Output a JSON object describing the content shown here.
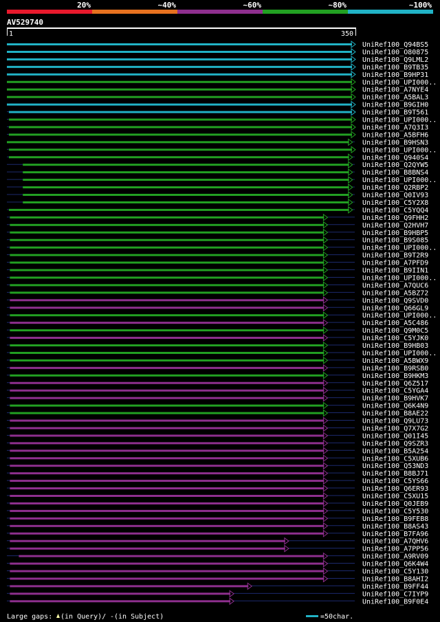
{
  "query_name": "AV529740",
  "colors": {
    "c20": "#e8192c",
    "c40": "#e6711f",
    "c60": "#8e2f8e",
    "c80": "#22a022",
    "c100": "#21b3c6"
  },
  "chart_data": {
    "type": "alignment-overview",
    "query_length": 350,
    "ruler_start": "1",
    "ruler_end": "350",
    "identity_scale": [
      {
        "label": "20%",
        "color": "#e8192c"
      },
      {
        "label": "~40%",
        "color": "#e6711f"
      },
      {
        "label": "~60%",
        "color": "#8e2f8e"
      },
      {
        "label": "~80%",
        "color": "#22a022"
      },
      {
        "label": "~100%",
        "color": "#21b3c6"
      }
    ],
    "hits": [
      {
        "name": "UniRef100_Q94BS5",
        "start": 1,
        "end": 350,
        "color": "#21b3c6"
      },
      {
        "name": "UniRef100_O80875",
        "start": 1,
        "end": 350,
        "color": "#21b3c6"
      },
      {
        "name": "UniRef100_Q9LML2",
        "start": 1,
        "end": 350,
        "color": "#21b3c6"
      },
      {
        "name": "UniRef100_B9TB35",
        "start": 1,
        "end": 350,
        "color": "#21b3c6"
      },
      {
        "name": "UniRef100_B9HP31",
        "start": 1,
        "end": 350,
        "color": "#21b3c6"
      },
      {
        "name": "UniRef100_UPI000..",
        "start": 1,
        "end": 350,
        "color": "#22a022"
      },
      {
        "name": "UniRef100_A7NYE4",
        "start": 1,
        "end": 350,
        "color": "#22a022"
      },
      {
        "name": "UniRef100_A5BAL3",
        "start": 1,
        "end": 350,
        "color": "#22a022"
      },
      {
        "name": "UniRef100_B9GIH0",
        "start": 1,
        "end": 350,
        "color": "#21b3c6"
      },
      {
        "name": "UniRef100_B9T561",
        "start": 3,
        "end": 350,
        "color": "#21b3c6"
      },
      {
        "name": "UniRef100_UPI000..",
        "start": 3,
        "end": 350,
        "color": "#22a022"
      },
      {
        "name": "UniRef100_A7Q3I3",
        "start": 3,
        "end": 350,
        "color": "#22a022"
      },
      {
        "name": "UniRef100_A5BFH6",
        "start": 3,
        "end": 350,
        "color": "#22a022"
      },
      {
        "name": "UniRef100_B9HSN3",
        "start": 1,
        "end": 347,
        "color": "#22a022"
      },
      {
        "name": "UniRef100_UPI000..",
        "start": 3,
        "end": 350,
        "color": "#22a022"
      },
      {
        "name": "UniRef100_Q940S4",
        "start": 3,
        "end": 347,
        "color": "#22a022"
      },
      {
        "name": "UniRef100_Q2QYW5",
        "start": 17,
        "end": 347,
        "color": "#22a022"
      },
      {
        "name": "UniRef100_B8BNS4",
        "start": 17,
        "end": 347,
        "color": "#22a022"
      },
      {
        "name": "UniRef100_UPI000..",
        "start": 17,
        "end": 347,
        "color": "#22a022"
      },
      {
        "name": "UniRef100_Q2RBP2",
        "start": 17,
        "end": 347,
        "color": "#22a022"
      },
      {
        "name": "UniRef100_Q0IV93",
        "start": 17,
        "end": 347,
        "color": "#22a022"
      },
      {
        "name": "UniRef100_C5Y2X8",
        "start": 17,
        "end": 347,
        "color": "#22a022"
      },
      {
        "name": "UniRef100_C5YQQ4",
        "start": 3,
        "end": 347,
        "color": "#22a022"
      },
      {
        "name": "UniRef100_Q9FHH2",
        "start": 4,
        "end": 322,
        "color": "#22a022"
      },
      {
        "name": "UniRef100_Q2HVH7",
        "start": 4,
        "end": 322,
        "color": "#22a022"
      },
      {
        "name": "UniRef100_B9HBP5",
        "start": 4,
        "end": 322,
        "color": "#22a022"
      },
      {
        "name": "UniRef100_B9S085",
        "start": 4,
        "end": 322,
        "color": "#22a022"
      },
      {
        "name": "UniRef100_UPI000..",
        "start": 4,
        "end": 322,
        "color": "#22a022"
      },
      {
        "name": "UniRef100_B9T2R9",
        "start": 4,
        "end": 322,
        "color": "#22a022"
      },
      {
        "name": "UniRef100_A7PFD9",
        "start": 4,
        "end": 322,
        "color": "#22a022"
      },
      {
        "name": "UniRef100_B9IIN1",
        "start": 4,
        "end": 322,
        "color": "#22a022"
      },
      {
        "name": "UniRef100_UPI000..",
        "start": 4,
        "end": 322,
        "color": "#22a022"
      },
      {
        "name": "UniRef100_A7QUC6",
        "start": 4,
        "end": 322,
        "color": "#22a022"
      },
      {
        "name": "UniRef100_A5BZ72",
        "start": 4,
        "end": 322,
        "color": "#22a022"
      },
      {
        "name": "UniRef100_Q9SVD0",
        "start": 4,
        "end": 322,
        "color": "#8e2f8e"
      },
      {
        "name": "UniRef100_Q66GL9",
        "start": 4,
        "end": 322,
        "color": "#8e2f8e"
      },
      {
        "name": "UniRef100_UPI000..",
        "start": 4,
        "end": 322,
        "color": "#22a022"
      },
      {
        "name": "UniRef100_A5C486",
        "start": 4,
        "end": 322,
        "color": "#8e2f8e"
      },
      {
        "name": "UniRef100_Q9M0C5",
        "start": 4,
        "end": 322,
        "color": "#22a022"
      },
      {
        "name": "UniRef100_C5YJK0",
        "start": 4,
        "end": 322,
        "color": "#8e2f8e"
      },
      {
        "name": "UniRef100_B9HB03",
        "start": 4,
        "end": 322,
        "color": "#22a022"
      },
      {
        "name": "UniRef100_UPI000..",
        "start": 4,
        "end": 322,
        "color": "#22a022"
      },
      {
        "name": "UniRef100_A5BWX9",
        "start": 4,
        "end": 322,
        "color": "#22a022"
      },
      {
        "name": "UniRef100_B9RSB0",
        "start": 4,
        "end": 322,
        "color": "#8e2f8e"
      },
      {
        "name": "UniRef100_B9HKM3",
        "start": 4,
        "end": 322,
        "color": "#22a022"
      },
      {
        "name": "UniRef100_Q6Z517",
        "start": 4,
        "end": 322,
        "color": "#8e2f8e"
      },
      {
        "name": "UniRef100_C5YGA4",
        "start": 4,
        "end": 322,
        "color": "#8e2f8e"
      },
      {
        "name": "UniRef100_B9HVK7",
        "start": 4,
        "end": 322,
        "color": "#8e2f8e"
      },
      {
        "name": "UniRef100_Q6K4N9",
        "start": 4,
        "end": 322,
        "color": "#22a022"
      },
      {
        "name": "UniRef100_B8AE22",
        "start": 4,
        "end": 322,
        "color": "#22a022"
      },
      {
        "name": "UniRef100_Q9LU73",
        "start": 4,
        "end": 322,
        "color": "#8e2f8e"
      },
      {
        "name": "UniRef100_Q7X7G2",
        "start": 4,
        "end": 322,
        "color": "#8e2f8e"
      },
      {
        "name": "UniRef100_Q01I45",
        "start": 4,
        "end": 322,
        "color": "#8e2f8e"
      },
      {
        "name": "UniRef100_Q9SZR3",
        "start": 4,
        "end": 322,
        "color": "#8e2f8e"
      },
      {
        "name": "UniRef100_B5A254",
        "start": 4,
        "end": 322,
        "color": "#8e2f8e"
      },
      {
        "name": "UniRef100_C5XUB6",
        "start": 4,
        "end": 322,
        "color": "#8e2f8e"
      },
      {
        "name": "UniRef100_Q53ND3",
        "start": 4,
        "end": 322,
        "color": "#8e2f8e"
      },
      {
        "name": "UniRef100_B8BJ71",
        "start": 4,
        "end": 322,
        "color": "#8e2f8e"
      },
      {
        "name": "UniRef100_C5YS66",
        "start": 4,
        "end": 322,
        "color": "#8e2f8e"
      },
      {
        "name": "UniRef100_Q6ER93",
        "start": 4,
        "end": 322,
        "color": "#8e2f8e"
      },
      {
        "name": "UniRef100_C5XU15",
        "start": 4,
        "end": 322,
        "color": "#8e2f8e"
      },
      {
        "name": "UniRef100_Q0JEB9",
        "start": 4,
        "end": 322,
        "color": "#8e2f8e"
      },
      {
        "name": "UniRef100_C5Y530",
        "start": 4,
        "end": 322,
        "color": "#8e2f8e"
      },
      {
        "name": "UniRef100_B9FEB8",
        "start": 4,
        "end": 322,
        "color": "#8e2f8e"
      },
      {
        "name": "UniRef100_B8AS43",
        "start": 4,
        "end": 322,
        "color": "#8e2f8e"
      },
      {
        "name": "UniRef100_B7FA96",
        "start": 4,
        "end": 322,
        "color": "#8e2f8e"
      },
      {
        "name": "UniRef100_A7QHV6",
        "start": 4,
        "end": 283,
        "color": "#8e2f8e"
      },
      {
        "name": "UniRef100_A7PP56",
        "start": 4,
        "end": 283,
        "color": "#8e2f8e"
      },
      {
        "name": "UniRef100_A9RV09",
        "start": 13,
        "end": 322,
        "color": "#8e2f8e"
      },
      {
        "name": "UniRef100_Q6K4W4",
        "start": 4,
        "end": 322,
        "color": "#8e2f8e"
      },
      {
        "name": "UniRef100_C5Y130",
        "start": 4,
        "end": 322,
        "color": "#8e2f8e"
      },
      {
        "name": "UniRef100_B8AHI2",
        "start": 4,
        "end": 322,
        "color": "#8e2f8e"
      },
      {
        "name": "UniRef100_B9FF44",
        "start": 4,
        "end": 246,
        "color": "#8e2f8e"
      },
      {
        "name": "UniRef100_C7IYP9",
        "start": 4,
        "end": 228,
        "color": "#8e2f8e"
      },
      {
        "name": "UniRef100_B9F0E4",
        "start": 4,
        "end": 228,
        "color": "#8e2f8e"
      }
    ],
    "legend": {
      "large_gaps_label": "Large gaps: ",
      "query_gap_label": "(in Query)/",
      "subject_gap_symbol": "-",
      "subject_gap_label": " (in Subject)",
      "scale_label": "=50char."
    }
  }
}
